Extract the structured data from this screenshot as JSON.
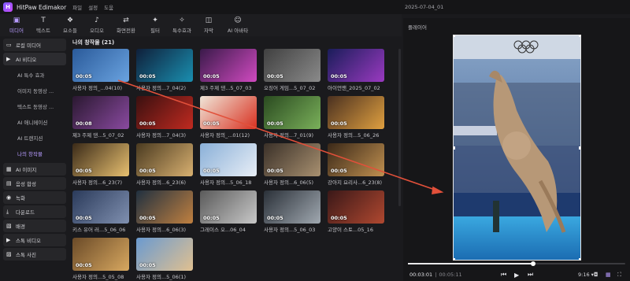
{
  "app": {
    "title": "HitPaw Edimakor",
    "menus": [
      "파일",
      "설정",
      "도움"
    ],
    "project_name": "2025-07-04_01",
    "accent": "#b79bff"
  },
  "toolbar": [
    {
      "label": "미디어",
      "icon": "media-icon",
      "glyph": "▣",
      "active": true
    },
    {
      "label": "텍스트",
      "icon": "text-icon",
      "glyph": "T"
    },
    {
      "label": "요소들",
      "icon": "elements-icon",
      "glyph": "❖"
    },
    {
      "label": "오디오",
      "icon": "audio-icon",
      "glyph": "♪"
    },
    {
      "label": "화면전환",
      "icon": "transition-icon",
      "glyph": "⇄"
    },
    {
      "label": "필터",
      "icon": "filter-icon",
      "glyph": "✦"
    },
    {
      "label": "특수효과",
      "icon": "effects-icon",
      "glyph": "✧"
    },
    {
      "label": "자막",
      "icon": "subtitle-icon",
      "glyph": "◫"
    },
    {
      "label": "AI 아바타",
      "icon": "ai-avatar-icon",
      "glyph": "☺"
    }
  ],
  "sidebar": {
    "groups": [
      {
        "label": "로컬 미디어",
        "icon": "folder-icon",
        "glyph": "▭"
      },
      {
        "label": "AI 비디오",
        "icon": "ai-video-icon",
        "glyph": "▶",
        "expanded": true,
        "items": [
          "AI 특수 효과",
          "이미지 동영상 ...",
          "텍스트 동영상 ...",
          "AI 애니메이션",
          "AI 트랜지션",
          "나의 창작물"
        ],
        "current": 5
      },
      {
        "label": "AI 이미지",
        "icon": "ai-image-icon",
        "glyph": "▦"
      },
      {
        "label": "음성 합성",
        "icon": "tts-icon",
        "glyph": "▤"
      },
      {
        "label": "녹화",
        "icon": "record-icon",
        "glyph": "◉"
      },
      {
        "label": "다운로드",
        "icon": "download-icon",
        "glyph": "⤓"
      },
      {
        "label": "배경",
        "icon": "background-icon",
        "glyph": "▧"
      },
      {
        "label": "스톡 비디오",
        "icon": "stock-video-icon",
        "glyph": "▶"
      },
      {
        "label": "스톡 사진",
        "icon": "stock-photo-icon",
        "glyph": "▨"
      }
    ]
  },
  "library": {
    "header": "나의 창작물 (21)",
    "items": [
      {
        "duration": "00:05",
        "caption": "사용자 정의_...04(10)",
        "colors": [
          "#2a5a9a",
          "#6aa3e0"
        ]
      },
      {
        "duration": "00:05",
        "caption": "사용자 정의...7_04(2)",
        "colors": [
          "#0f1f3a",
          "#1a8fb0"
        ]
      },
      {
        "duration": "00:05",
        "caption": "제3 주제 댄...5_07_03",
        "colors": [
          "#3a1a4a",
          "#d04ac0"
        ]
      },
      {
        "duration": "00:05",
        "caption": "오징어 게임...5_07_02",
        "colors": [
          "#404040",
          "#8a8a8a"
        ]
      },
      {
        "duration": "00:05",
        "caption": "아이언맨_2025_07_02",
        "colors": [
          "#1a1d5a",
          "#9a3ac0"
        ]
      },
      {
        "duration": "00:08",
        "caption": "제3 주제 댄...5_07_02",
        "colors": [
          "#2a1830",
          "#8a4aa0"
        ]
      },
      {
        "duration": "00:05",
        "caption": "사용자 정의...7_04(3)",
        "colors": [
          "#3a1010",
          "#c02a20"
        ]
      },
      {
        "duration": "00:05",
        "caption": "사용자 정의_...01(12)",
        "colors": [
          "#f0e6d8",
          "#d83020"
        ]
      },
      {
        "duration": "00:05",
        "caption": "사용자 정의...7_01(9)",
        "colors": [
          "#2a4a20",
          "#7ab05a"
        ]
      },
      {
        "duration": "00:05",
        "caption": "사용자 정의...5_06_26",
        "colors": [
          "#4a3020",
          "#e0a040"
        ]
      },
      {
        "duration": "00:05",
        "caption": "사용자 정의...6_23(7)",
        "colors": [
          "#3a2a18",
          "#e8c070"
        ]
      },
      {
        "duration": "00:05",
        "caption": "사용자 정의...6_23(6)",
        "colors": [
          "#4a3a20",
          "#d8b070"
        ]
      },
      {
        "duration": "00:05",
        "caption": "사용자 정의...5_06_18",
        "colors": [
          "#8ab0d8",
          "#e8eef6"
        ]
      },
      {
        "duration": "00:05",
        "caption": "사용자 정의...6_06(5)",
        "colors": [
          "#3a3028",
          "#a89070"
        ]
      },
      {
        "duration": "00:05",
        "caption": "강아지 요리사...6_23(8)",
        "colors": [
          "#3a2818",
          "#c09050"
        ]
      },
      {
        "duration": "00:05",
        "caption": "키스 유어 러...5_06_06",
        "colors": [
          "#2a3a5a",
          "#8090b0"
        ]
      },
      {
        "duration": "00:05",
        "caption": "사용자 정의...6_06(3)",
        "colors": [
          "#203040",
          "#c08040"
        ]
      },
      {
        "duration": "00:05",
        "caption": "그레이스 오...06_04",
        "colors": [
          "#5a5a5a",
          "#c8c8c8"
        ]
      },
      {
        "duration": "00:05",
        "caption": "사용자 정의...5_06_03",
        "colors": [
          "#2a3038",
          "#a0a8b0"
        ]
      },
      {
        "duration": "00:05",
        "caption": "고양이 스토...05_16",
        "colors": [
          "#3a1818",
          "#b04830"
        ]
      },
      {
        "duration": "00:05",
        "caption": "사용자 정의...5_05_08",
        "colors": [
          "#6a4a28",
          "#d8a860"
        ]
      },
      {
        "duration": "00:05",
        "caption": "사용자 정의...5_06(1)",
        "colors": [
          "#6a9ad0",
          "#e0c090"
        ]
      }
    ]
  },
  "player": {
    "label": "플레이어",
    "current_time": "00:03:01",
    "total_time": "00:05:11",
    "progress": 0.575,
    "aspect_ratio": "9:16"
  }
}
